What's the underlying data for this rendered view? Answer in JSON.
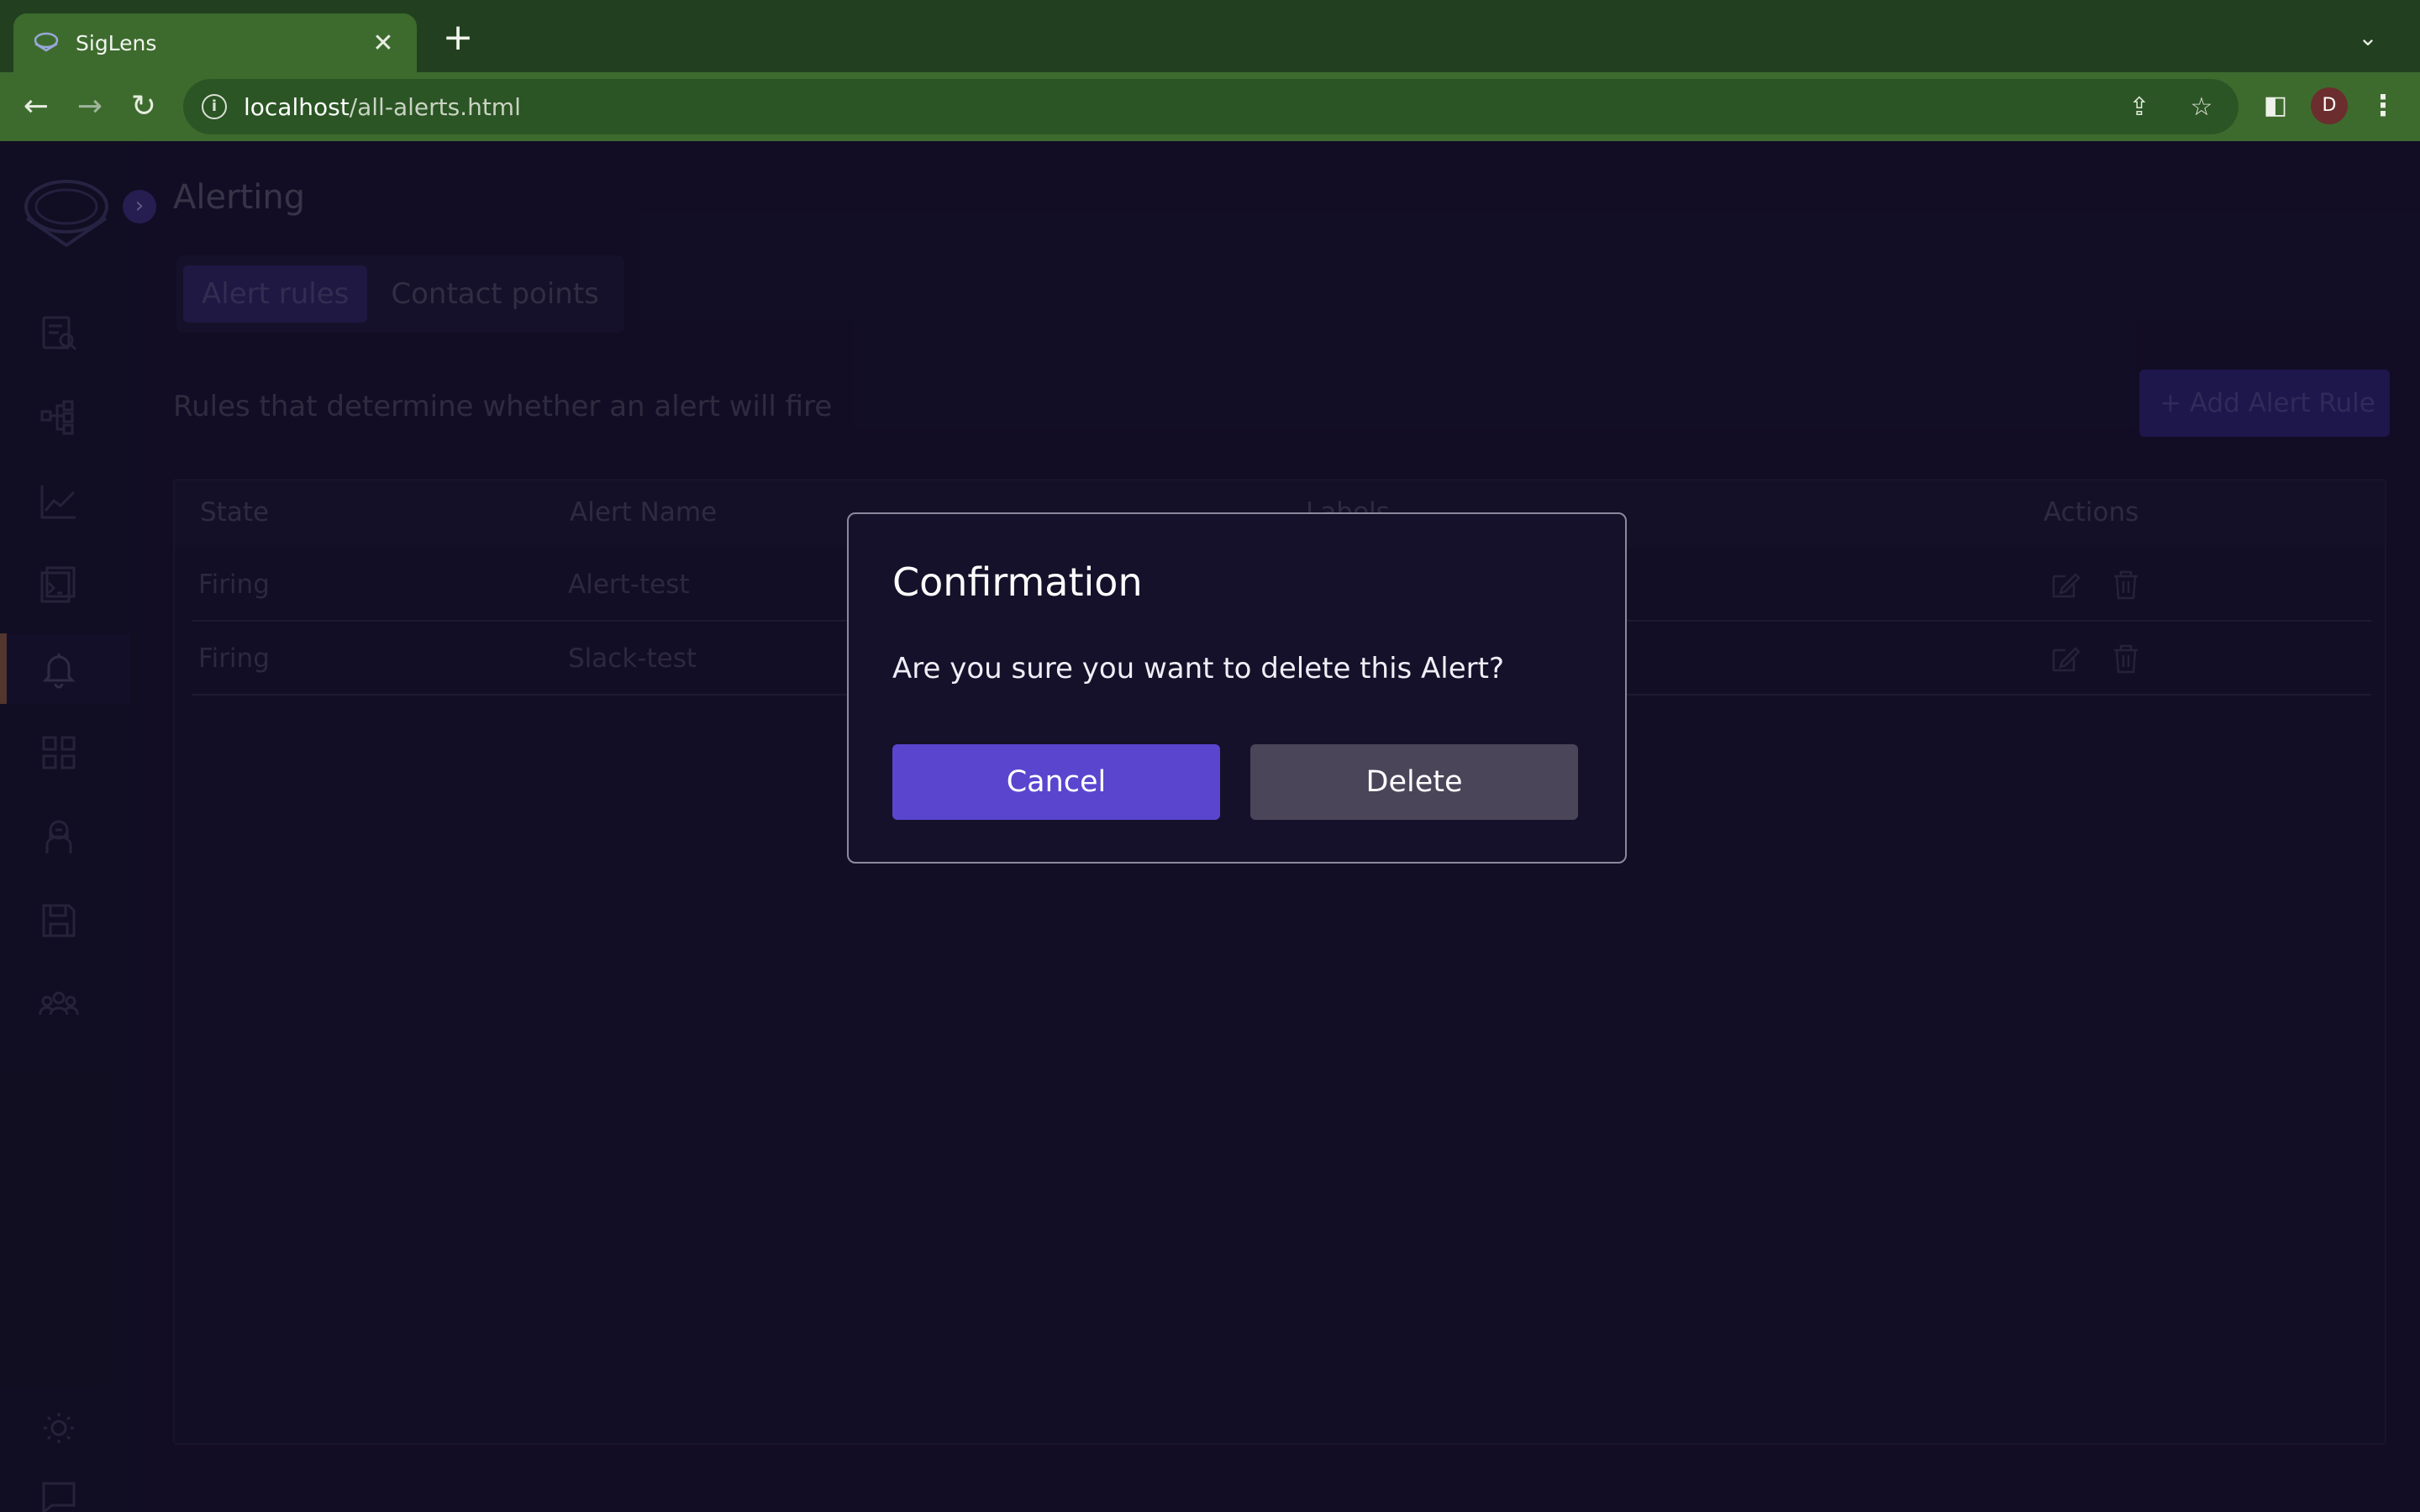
{
  "browser": {
    "tab_title": "SigLens",
    "url_host": "localhost",
    "url_path": "/all-alerts.html",
    "profile_initial": "D"
  },
  "page": {
    "title": "Alerting",
    "tabs": [
      {
        "label": "Alert rules",
        "active": true
      },
      {
        "label": "Contact points",
        "active": false
      }
    ],
    "subtitle": "Rules that determine whether an alert will fire",
    "add_button": "+ Add Alert Rule"
  },
  "table": {
    "columns": [
      "State",
      "Alert Name",
      "Labels",
      "Actions"
    ],
    "rows": [
      {
        "state": "Firing",
        "name": "Alert-test"
      },
      {
        "state": "Firing",
        "name": "Slack-test"
      }
    ]
  },
  "sidebar": {
    "items": [
      "search-icon",
      "service-map-icon",
      "metrics-icon",
      "live-tail-icon",
      "alert-bell-icon",
      "dashboards-icon",
      "ops-icon",
      "saved-queries-icon",
      "users-icon"
    ],
    "active_item": "alert-bell-icon",
    "bottom_items": [
      "theme-toggle-icon",
      "feedback-icon"
    ]
  },
  "modal": {
    "title": "Confirmation",
    "message": "Are you sure you want to delete this Alert?",
    "cancel": "Cancel",
    "delete": "Delete"
  },
  "colors": {
    "accent": "#5a45cf",
    "browser_green": "#3d6b2e",
    "app_bg": "#14102a"
  }
}
